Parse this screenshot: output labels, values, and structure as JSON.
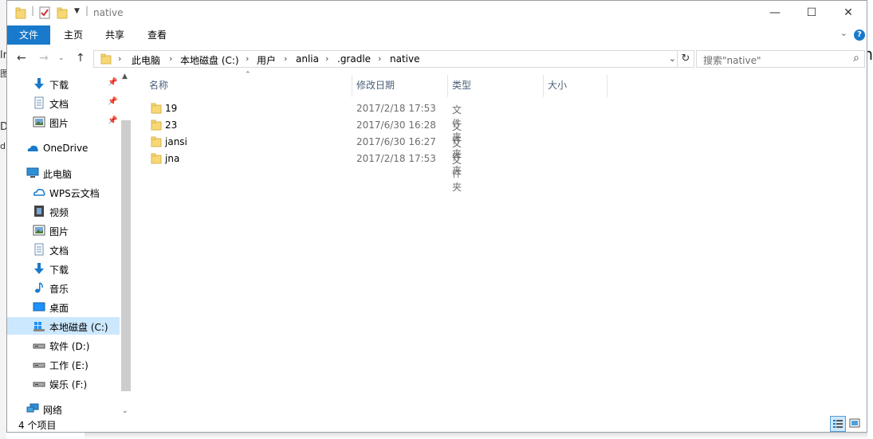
{
  "window": {
    "title": "native",
    "controls": {
      "minimize": "—",
      "maximize": "☐",
      "close": "✕"
    }
  },
  "ribbon": {
    "tabs": [
      {
        "label": "文件"
      },
      {
        "label": "主页"
      },
      {
        "label": "共享"
      },
      {
        "label": "查看"
      }
    ],
    "help": "?"
  },
  "address": {
    "crumbs": [
      "此电脑",
      "本地磁盘 (C:)",
      "用户",
      "anlia",
      ".gradle",
      "native"
    ]
  },
  "search": {
    "placeholder": "搜索\"native\""
  },
  "nav": {
    "quick_access": [
      {
        "label": "下载",
        "icon": "download-icon"
      },
      {
        "label": "文档",
        "icon": "documents-icon"
      },
      {
        "label": "图片",
        "icon": "pictures-icon"
      }
    ],
    "onedrive": "OneDrive",
    "this_pc": "此电脑",
    "pc_items": [
      {
        "label": "WPS云文档",
        "icon": "cloud-icon"
      },
      {
        "label": "视频",
        "icon": "video-icon"
      },
      {
        "label": "图片",
        "icon": "pictures-icon"
      },
      {
        "label": "文档",
        "icon": "documents-icon"
      },
      {
        "label": "下载",
        "icon": "download-icon"
      },
      {
        "label": "音乐",
        "icon": "music-icon"
      },
      {
        "label": "桌面",
        "icon": "desktop-icon"
      },
      {
        "label": "本地磁盘 (C:)",
        "icon": "windows-drive-icon",
        "selected": true
      },
      {
        "label": "软件 (D:)",
        "icon": "drive-icon"
      },
      {
        "label": "工作 (E:)",
        "icon": "drive-icon"
      },
      {
        "label": "娱乐 (F:)",
        "icon": "drive-icon"
      }
    ],
    "network": "网络"
  },
  "columns": [
    "名称",
    "修改日期",
    "类型",
    "大小"
  ],
  "files": [
    {
      "name": "19",
      "date": "2017/2/18 17:53",
      "type": "文件夹"
    },
    {
      "name": "23",
      "date": "2017/6/30 16:28",
      "type": "文件夹"
    },
    {
      "name": "jansi",
      "date": "2017/6/30 16:27",
      "type": "文件夹"
    },
    {
      "name": "jna",
      "date": "2017/2/18 17:53",
      "type": "文件夹"
    }
  ],
  "status": {
    "item_count": "4 个项目"
  },
  "background": {
    "left_chars": [
      "lr",
      "图",
      "De",
      "d"
    ],
    "right_char": "n"
  },
  "colors": {
    "accent": "#1979ca",
    "selected": "#cce8ff",
    "folder": "#f8d775"
  }
}
